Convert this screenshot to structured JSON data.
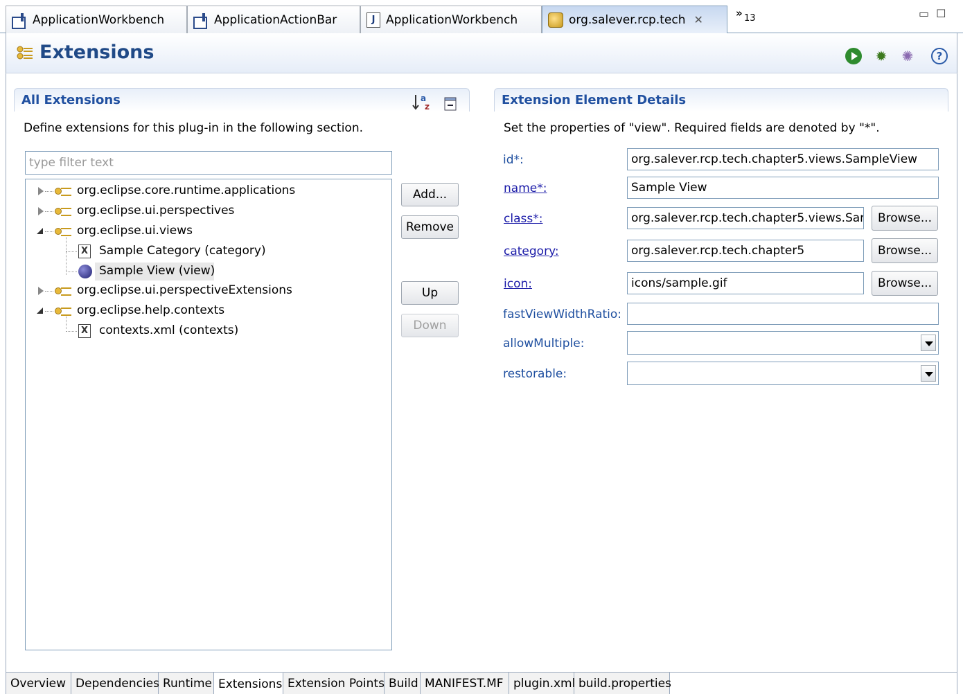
{
  "editor_tabs": [
    {
      "label": "ApplicationWorkbench",
      "icon": "class-file-icon"
    },
    {
      "label": "ApplicationActionBar",
      "icon": "class-file-icon"
    },
    {
      "label": "ApplicationWorkbench",
      "icon": "java-file-icon"
    },
    {
      "label": "org.salever.rcp.tech",
      "icon": "plugin-manifest-icon",
      "active": true
    }
  ],
  "overflow_chevron": "»",
  "overflow_count": "13",
  "form": {
    "title": "Extensions"
  },
  "all_extensions": {
    "title": "All Extensions",
    "description": "Define extensions for this plug-in in the following section.",
    "filter_placeholder": "type filter text",
    "tree": [
      {
        "label": "org.eclipse.core.runtime.applications",
        "icon": "extension-icon",
        "state": "collapsed"
      },
      {
        "label": "org.eclipse.ui.perspectives",
        "icon": "extension-icon",
        "state": "collapsed"
      },
      {
        "label": "org.eclipse.ui.views",
        "icon": "extension-icon",
        "state": "expanded"
      },
      {
        "label": "Sample Category (category)",
        "icon": "xml-element-icon",
        "child": true
      },
      {
        "label": "Sample View (view)",
        "icon": "view-icon",
        "child": true,
        "selected": true
      },
      {
        "label": "org.eclipse.ui.perspectiveExtensions",
        "icon": "extension-icon",
        "state": "collapsed"
      },
      {
        "label": "org.eclipse.help.contexts",
        "icon": "extension-icon",
        "state": "expanded"
      },
      {
        "label": "contexts.xml (contexts)",
        "icon": "xml-element-icon",
        "child": true
      }
    ],
    "buttons": {
      "add": "Add...",
      "remove": "Remove",
      "up": "Up",
      "down": "Down"
    }
  },
  "details": {
    "title": "Extension Element Details",
    "description": "Set the properties of \"view\". Required fields are denoted by \"*\".",
    "browse_label": "Browse...",
    "fields": {
      "id": {
        "label": "id*:",
        "value": "org.salever.rcp.tech.chapter5.views.SampleView"
      },
      "name": {
        "label": "name*:",
        "value": "Sample View"
      },
      "class": {
        "label": "class*:",
        "value": "org.salever.rcp.tech.chapter5.views.Sar"
      },
      "category": {
        "label": "category:",
        "value": "org.salever.rcp.tech.chapter5"
      },
      "icon": {
        "label": "icon:",
        "value": "icons/sample.gif"
      },
      "fastViewWidthRatio": {
        "label": "fastViewWidthRatio:",
        "value": ""
      },
      "allowMultiple": {
        "label": "allowMultiple:",
        "value": ""
      },
      "restorable": {
        "label": "restorable:",
        "value": ""
      }
    }
  },
  "page_tabs": [
    "Overview",
    "Dependencies",
    "Runtime",
    "Extensions",
    "Extension Points",
    "Build",
    "MANIFEST.MF",
    "plugin.xml",
    "build.properties"
  ],
  "active_page_tab": "Extensions",
  "colors": {
    "title": "#204a87",
    "section_title": "#2050a0",
    "link": "#1a1aa8"
  }
}
